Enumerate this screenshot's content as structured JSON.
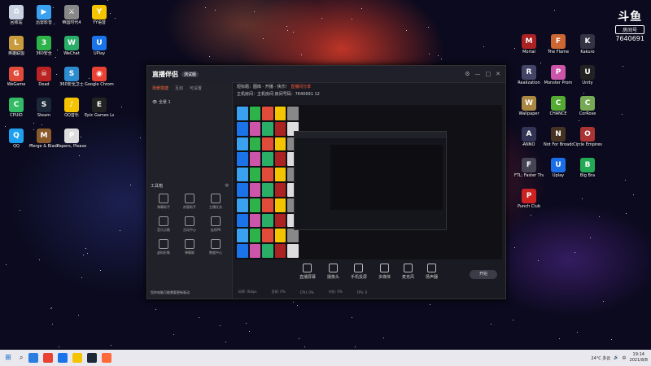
{
  "brand": {
    "logo": "斗鱼",
    "sub": "房间号",
    "room": "7640691"
  },
  "desktop_left": [
    {
      "label": "回收站",
      "color": "#c8d2e0",
      "glyph": "♻"
    },
    {
      "label": "迅雷影音",
      "color": "#3aa0f0",
      "glyph": "▶"
    },
    {
      "label": "帝国时代4",
      "color": "#888",
      "glyph": "⚔"
    },
    {
      "label": "YY语音",
      "color": "#f5c400",
      "glyph": "Y"
    },
    {
      "label": "英雄联盟",
      "color": "#c89b3c",
      "glyph": "L"
    },
    {
      "label": "360安全",
      "color": "#2db34a",
      "glyph": "3"
    },
    {
      "label": "WeChat",
      "color": "#2aae67",
      "glyph": "W"
    },
    {
      "label": "UPlay",
      "color": "#1a73e8",
      "glyph": "U"
    },
    {
      "label": "WeGame",
      "color": "#e14b3a",
      "glyph": "G"
    },
    {
      "label": "Dead",
      "color": "#b22",
      "glyph": "☠"
    },
    {
      "label": "360安全卫士",
      "color": "#2d8cd0",
      "glyph": "S"
    },
    {
      "label": "Google Chrome",
      "color": "#e94235",
      "glyph": "◉"
    },
    {
      "label": "CPUID",
      "color": "#3b6",
      "glyph": "C"
    },
    {
      "label": "Steam",
      "color": "#1b2838",
      "glyph": "S"
    },
    {
      "label": "QQ音乐",
      "color": "#f5c400",
      "glyph": "♪"
    },
    {
      "label": "Epic Games Launcher",
      "color": "#222",
      "glyph": "E"
    },
    {
      "label": "QQ",
      "color": "#1ea0f1",
      "glyph": "Q"
    },
    {
      "label": "Merge & Blade",
      "color": "#8a5a2a",
      "glyph": "M"
    },
    {
      "label": "Papers, Please",
      "color": "#ddd",
      "glyph": "P"
    }
  ],
  "desktop_right": [
    {
      "label": "Mortal",
      "color": "#a22",
      "glyph": "M"
    },
    {
      "label": "The Flame",
      "color": "#c63",
      "glyph": "F"
    },
    {
      "label": "Kakuro",
      "color": "#334",
      "glyph": "K"
    },
    {
      "label": "Realization",
      "color": "#446",
      "glyph": "R"
    },
    {
      "label": "Monster Prom",
      "color": "#c5a",
      "glyph": "P"
    },
    {
      "label": "Unity",
      "color": "#222",
      "glyph": "U"
    },
    {
      "label": "Wallpaper",
      "color": "#a84",
      "glyph": "W"
    },
    {
      "label": "CHANCE",
      "color": "#5a3",
      "glyph": "C"
    },
    {
      "label": "CorRose",
      "color": "#7a5",
      "glyph": "C"
    },
    {
      "label": "ANNO",
      "color": "#335",
      "glyph": "A"
    },
    {
      "label": "Not For Broadcast",
      "color": "#432",
      "glyph": "N"
    },
    {
      "label": "Circle Empires",
      "color": "#a33",
      "glyph": "O"
    },
    {
      "label": "FTL: Faster Than Light",
      "color": "#445",
      "glyph": "F"
    },
    {
      "label": "Uplay",
      "color": "#1a6ee8",
      "glyph": "U"
    },
    {
      "label": "Big Bra",
      "color": "#2a5",
      "glyph": "B"
    },
    {
      "label": "Punch Club",
      "color": "#c22",
      "glyph": "P"
    }
  ],
  "window": {
    "app_title": "直播伴侣",
    "badge": "测试版",
    "sidebar_tabs": [
      "场景搭建",
      "互动",
      "可设置"
    ],
    "scene_label": "全景 1",
    "tools_header": "工具箱",
    "tools": [
      "弹幕助手",
      "房管助手",
      "主播任务",
      "音乐点歌",
      "活动中心",
      "连线PK",
      "虚拟形象",
      "弹幕姬",
      "数据中心"
    ],
    "warning": "您的电脑可能需要更新驱动",
    "info_line1": "短标题：图库 · 开播 · 快乐！",
    "info_tag": "直播间分享",
    "info_line2": "主机房间：主机房间",
    "info_room": "房间号码：7640691",
    "info_count": "12",
    "controls": [
      "直播屏幕",
      "摄像头",
      "手机投屏",
      "多媒体",
      "麦克风",
      "扬声器"
    ],
    "go_live": "开始",
    "status": [
      "码率: 0kbps",
      "丢帧: 0%",
      "CPU: 0%",
      "内存: 0%",
      "FPS: 0"
    ]
  },
  "taskbar": {
    "weather": "24°C 多云",
    "time": "19:14",
    "date": "2021/8/8",
    "lang": "中"
  }
}
